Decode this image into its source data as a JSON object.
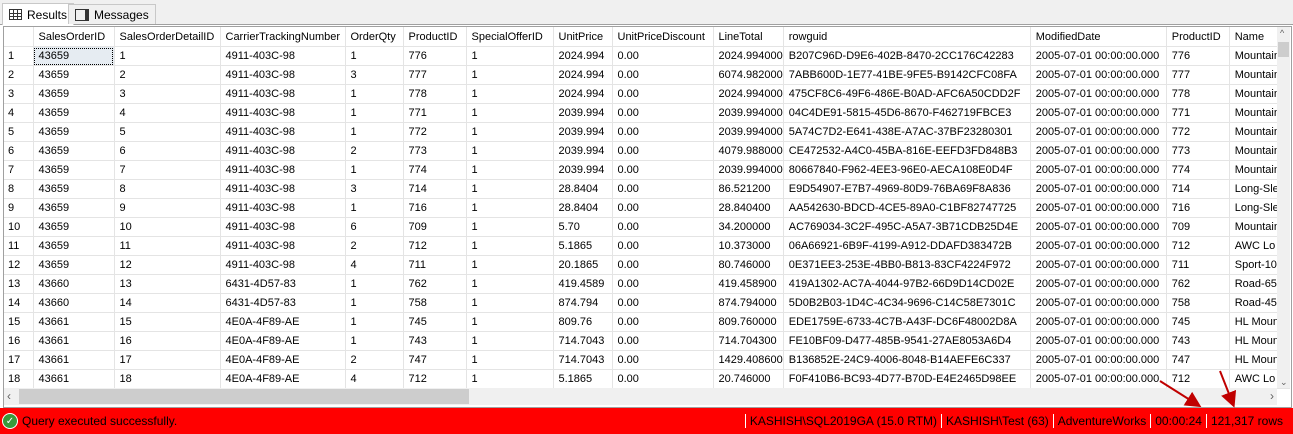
{
  "tabs": [
    {
      "label": "Results"
    },
    {
      "label": "Messages"
    }
  ],
  "columns": [
    "",
    "SalesOrderID",
    "SalesOrderDetailID",
    "CarrierTrackingNumber",
    "OrderQty",
    "ProductID",
    "SpecialOfferID",
    "UnitPrice",
    "UnitPriceDiscount",
    "LineTotal",
    "rowguid",
    "ModifiedDate",
    "ProductID",
    "Name"
  ],
  "rows": [
    [
      "1",
      "43659",
      "1",
      "4911-403C-98",
      "1",
      "776",
      "1",
      "2024.994",
      "0.00",
      "2024.994000",
      "B207C96D-D9E6-402B-8470-2CC176C42283",
      "2005-07-01 00:00:00.000",
      "776",
      "Mountain"
    ],
    [
      "2",
      "43659",
      "2",
      "4911-403C-98",
      "3",
      "777",
      "1",
      "2024.994",
      "0.00",
      "6074.982000",
      "7ABB600D-1E77-41BE-9FE5-B9142CFC08FA",
      "2005-07-01 00:00:00.000",
      "777",
      "Mountain"
    ],
    [
      "3",
      "43659",
      "3",
      "4911-403C-98",
      "1",
      "778",
      "1",
      "2024.994",
      "0.00",
      "2024.994000",
      "475CF8C6-49F6-486E-B0AD-AFC6A50CDD2F",
      "2005-07-01 00:00:00.000",
      "778",
      "Mountain"
    ],
    [
      "4",
      "43659",
      "4",
      "4911-403C-98",
      "1",
      "771",
      "1",
      "2039.994",
      "0.00",
      "2039.994000",
      "04C4DE91-5815-45D6-8670-F462719FBCE3",
      "2005-07-01 00:00:00.000",
      "771",
      "Mountain"
    ],
    [
      "5",
      "43659",
      "5",
      "4911-403C-98",
      "1",
      "772",
      "1",
      "2039.994",
      "0.00",
      "2039.994000",
      "5A74C7D2-E641-438E-A7AC-37BF23280301",
      "2005-07-01 00:00:00.000",
      "772",
      "Mountain"
    ],
    [
      "6",
      "43659",
      "6",
      "4911-403C-98",
      "2",
      "773",
      "1",
      "2039.994",
      "0.00",
      "4079.988000",
      "CE472532-A4C0-45BA-816E-EEFD3FD848B3",
      "2005-07-01 00:00:00.000",
      "773",
      "Mountain"
    ],
    [
      "7",
      "43659",
      "7",
      "4911-403C-98",
      "1",
      "774",
      "1",
      "2039.994",
      "0.00",
      "2039.994000",
      "80667840-F962-4EE3-96E0-AECA108E0D4F",
      "2005-07-01 00:00:00.000",
      "774",
      "Mountain"
    ],
    [
      "8",
      "43659",
      "8",
      "4911-403C-98",
      "3",
      "714",
      "1",
      "28.8404",
      "0.00",
      "86.521200",
      "E9D54907-E7B7-4969-80D9-76BA69F8A836",
      "2005-07-01 00:00:00.000",
      "714",
      "Long-Sle"
    ],
    [
      "9",
      "43659",
      "9",
      "4911-403C-98",
      "1",
      "716",
      "1",
      "28.8404",
      "0.00",
      "28.840400",
      "AA542630-BDCD-4CE5-89A0-C1BF82747725",
      "2005-07-01 00:00:00.000",
      "716",
      "Long-Sle"
    ],
    [
      "10",
      "43659",
      "10",
      "4911-403C-98",
      "6",
      "709",
      "1",
      "5.70",
      "0.00",
      "34.200000",
      "AC769034-3C2F-495C-A5A7-3B71CDB25D4E",
      "2005-07-01 00:00:00.000",
      "709",
      "Mountain"
    ],
    [
      "11",
      "43659",
      "11",
      "4911-403C-98",
      "2",
      "712",
      "1",
      "5.1865",
      "0.00",
      "10.373000",
      "06A66921-6B9F-4199-A912-DDAFD383472B",
      "2005-07-01 00:00:00.000",
      "712",
      "AWC Lo"
    ],
    [
      "12",
      "43659",
      "12",
      "4911-403C-98",
      "4",
      "711",
      "1",
      "20.1865",
      "0.00",
      "80.746000",
      "0E371EE3-253E-4BB0-B813-83CF4224F972",
      "2005-07-01 00:00:00.000",
      "711",
      "Sport-10"
    ],
    [
      "13",
      "43660",
      "13",
      "6431-4D57-83",
      "1",
      "762",
      "1",
      "419.4589",
      "0.00",
      "419.458900",
      "419A1302-AC7A-4044-97B2-66D9D14CD02E",
      "2005-07-01 00:00:00.000",
      "762",
      "Road-65"
    ],
    [
      "14",
      "43660",
      "14",
      "6431-4D57-83",
      "1",
      "758",
      "1",
      "874.794",
      "0.00",
      "874.794000",
      "5D0B2B03-1D4C-4C34-9696-C14C58E7301C",
      "2005-07-01 00:00:00.000",
      "758",
      "Road-45"
    ],
    [
      "15",
      "43661",
      "15",
      "4E0A-4F89-AE",
      "1",
      "745",
      "1",
      "809.76",
      "0.00",
      "809.760000",
      "EDE1759E-6733-4C7B-A43F-DC6F48002D8A",
      "2005-07-01 00:00:00.000",
      "745",
      "HL Moun"
    ],
    [
      "16",
      "43661",
      "16",
      "4E0A-4F89-AE",
      "1",
      "743",
      "1",
      "714.7043",
      "0.00",
      "714.704300",
      "FE10BF09-D477-485B-9541-27AE8053A6D4",
      "2005-07-01 00:00:00.000",
      "743",
      "HL Moun"
    ],
    [
      "17",
      "43661",
      "17",
      "4E0A-4F89-AE",
      "2",
      "747",
      "1",
      "714.7043",
      "0.00",
      "1429.408600",
      "B136852E-24C9-4006-8048-B14AEFE6C337",
      "2005-07-01 00:00:00.000",
      "747",
      "HL Moun"
    ],
    [
      "18",
      "43661",
      "18",
      "4E0A-4F89-AE",
      "4",
      "712",
      "1",
      "5.1865",
      "0.00",
      "20.746000",
      "F0F410B6-BC93-4D77-B70D-E4E2465D98EE",
      "2005-07-01 00:00:00.000",
      "712",
      "AWC Lo"
    ]
  ],
  "status": {
    "message": "Query executed successfully.",
    "server": "KASHISH\\SQL2019GA (15.0 RTM)",
    "user": "KASHISH\\Test (63)",
    "database": "AdventureWorks",
    "elapsed": "00:00:24",
    "rows": "121,317 rows",
    "color": "#ff0000"
  }
}
